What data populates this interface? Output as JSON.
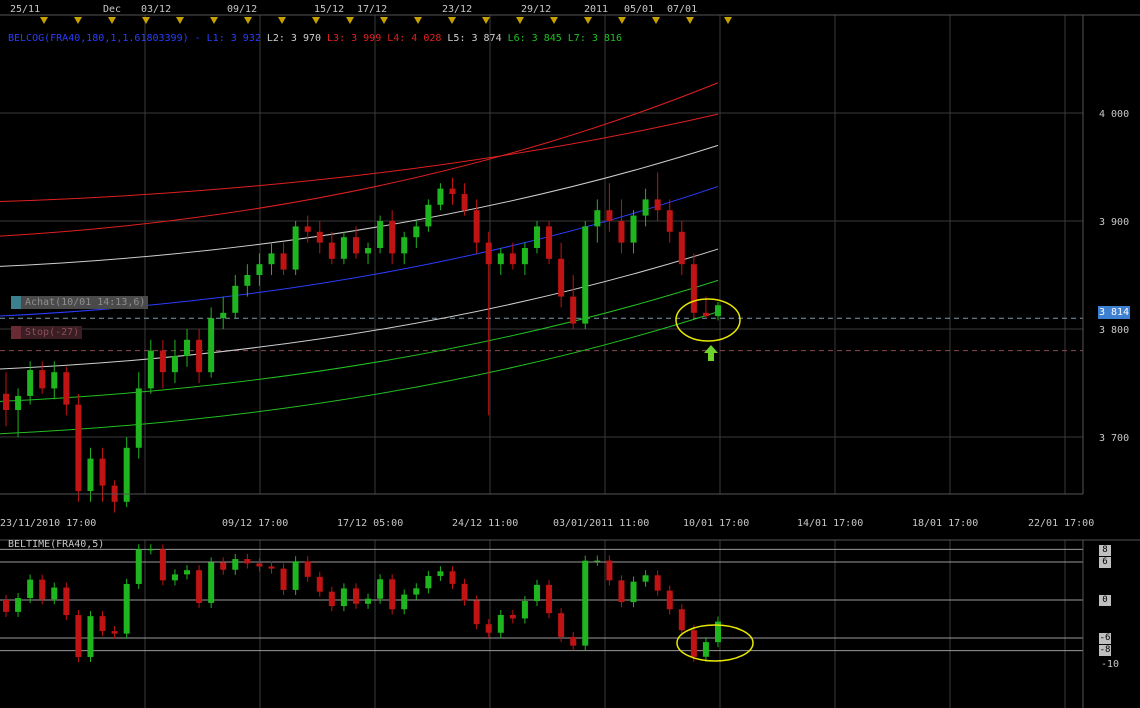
{
  "top_date_labels": [
    "25/11",
    "Dec",
    "03/12",
    "09/12",
    "15/12",
    "17/12",
    "23/12",
    "29/12",
    "2011",
    "05/01",
    "07/01"
  ],
  "bottom_date_labels": [
    "23/11/2010 17:00",
    "09/12 17:00",
    "17/12 05:00",
    "24/12 11:00",
    "03/01/2011 11:00",
    "10/01 17:00",
    "14/01 17:00",
    "18/01 17:00",
    "22/01 17:00"
  ],
  "legend": {
    "prefix": "BELCOG(FRA40,180,1,1.61803399) -",
    "items": [
      {
        "text": "L1: 3 932",
        "color": "#2a3dff"
      },
      {
        "text": "L2: 3 970",
        "color": "#d0d0d0"
      },
      {
        "text": "L3: 3 999",
        "color": "#e02020"
      },
      {
        "text": "L4: 4 028",
        "color": "#e02020"
      },
      {
        "text": "L5: 3 874",
        "color": "#d0d0d0"
      },
      {
        "text": "L6: 3 845",
        "color": "#22c022"
      },
      {
        "text": "L7: 3 816",
        "color": "#22c022"
      }
    ]
  },
  "badges": {
    "buy": "Achat(10/01 14:13,6)",
    "stop": "Stop(-27)"
  },
  "price_tag": "3 814",
  "subchart": {
    "title": "BELTIME(FRA40,5)",
    "axis_labels": [
      "8",
      "6",
      "0",
      "-6",
      "-8",
      "-10"
    ]
  },
  "colors": {
    "up": "#1fb51f",
    "down": "#c01414",
    "blue": "#2a3dff",
    "white": "#cfcfcf",
    "red": "#e02020",
    "green": "#22c022",
    "grid": "#3a3a3a",
    "highlight": "#e8e800",
    "arrow": "#6fd12b"
  },
  "chart_data": [
    {
      "type": "candlestick",
      "instrument": "FRA40",
      "yticks": [
        4000,
        3900,
        3800,
        3700
      ],
      "ylim": [
        3625,
        4080
      ],
      "current_price": 3814,
      "ref_lines": [
        3810,
        3780
      ],
      "bands": [
        {
          "name": "L3",
          "color": "#e02020",
          "start": 3918,
          "end": 3999,
          "slope": "up"
        },
        {
          "name": "L4",
          "color": "#e02020",
          "start": 3886,
          "end": 4028,
          "slope": "up"
        },
        {
          "name": "L2",
          "color": "#cfcfcf",
          "start": 3858,
          "end": 3970,
          "slope": "up"
        },
        {
          "name": "L1",
          "color": "#2a3dff",
          "start": 3812,
          "end": 3932,
          "slope": "up"
        },
        {
          "name": "L5",
          "color": "#cfcfcf",
          "start": 3763,
          "end": 3874,
          "slope": "up"
        },
        {
          "name": "L6",
          "color": "#22c022",
          "start": 3733,
          "end": 3845,
          "slope": "up"
        },
        {
          "name": "L7",
          "color": "#22c022",
          "start": 3703,
          "end": 3816,
          "slope": "up"
        }
      ],
      "candles": [
        [
          3740,
          3760,
          3710,
          3725
        ],
        [
          3725,
          3745,
          3700,
          3738
        ],
        [
          3738,
          3770,
          3730,
          3762
        ],
        [
          3762,
          3770,
          3740,
          3745
        ],
        [
          3745,
          3770,
          3735,
          3760
        ],
        [
          3760,
          3765,
          3720,
          3730
        ],
        [
          3730,
          3740,
          3640,
          3650
        ],
        [
          3650,
          3690,
          3640,
          3680
        ],
        [
          3680,
          3690,
          3640,
          3655
        ],
        [
          3655,
          3660,
          3630,
          3640
        ],
        [
          3640,
          3700,
          3635,
          3690
        ],
        [
          3690,
          3760,
          3680,
          3745
        ],
        [
          3745,
          3790,
          3740,
          3780
        ],
        [
          3780,
          3790,
          3745,
          3760
        ],
        [
          3760,
          3790,
          3750,
          3775
        ],
        [
          3775,
          3800,
          3765,
          3790
        ],
        [
          3790,
          3800,
          3750,
          3760
        ],
        [
          3760,
          3820,
          3755,
          3810
        ],
        [
          3810,
          3830,
          3800,
          3815
        ],
        [
          3815,
          3850,
          3810,
          3840
        ],
        [
          3840,
          3860,
          3830,
          3850
        ],
        [
          3850,
          3870,
          3840,
          3860
        ],
        [
          3860,
          3880,
          3850,
          3870
        ],
        [
          3870,
          3880,
          3850,
          3855
        ],
        [
          3855,
          3900,
          3850,
          3895
        ],
        [
          3895,
          3905,
          3880,
          3890
        ],
        [
          3890,
          3900,
          3870,
          3880
        ],
        [
          3880,
          3890,
          3860,
          3865
        ],
        [
          3865,
          3890,
          3860,
          3885
        ],
        [
          3885,
          3895,
          3865,
          3870
        ],
        [
          3870,
          3880,
          3860,
          3875
        ],
        [
          3875,
          3905,
          3870,
          3900
        ],
        [
          3900,
          3910,
          3860,
          3870
        ],
        [
          3870,
          3890,
          3860,
          3885
        ],
        [
          3885,
          3900,
          3875,
          3895
        ],
        [
          3895,
          3920,
          3890,
          3915
        ],
        [
          3915,
          3935,
          3910,
          3930
        ],
        [
          3930,
          3940,
          3915,
          3925
        ],
        [
          3925,
          3935,
          3905,
          3910
        ],
        [
          3910,
          3920,
          3870,
          3880
        ],
        [
          3880,
          3890,
          3720,
          3860
        ],
        [
          3860,
          3875,
          3850,
          3870
        ],
        [
          3870,
          3880,
          3855,
          3860
        ],
        [
          3860,
          3880,
          3850,
          3875
        ],
        [
          3875,
          3900,
          3870,
          3895
        ],
        [
          3895,
          3900,
          3860,
          3865
        ],
        [
          3865,
          3880,
          3820,
          3830
        ],
        [
          3830,
          3850,
          3800,
          3805
        ],
        [
          3805,
          3900,
          3800,
          3895
        ],
        [
          3895,
          3920,
          3880,
          3910
        ],
        [
          3910,
          3935,
          3890,
          3900
        ],
        [
          3900,
          3920,
          3870,
          3880
        ],
        [
          3880,
          3910,
          3870,
          3905
        ],
        [
          3905,
          3930,
          3895,
          3920
        ],
        [
          3920,
          3945,
          3900,
          3910
        ],
        [
          3910,
          3920,
          3880,
          3890
        ],
        [
          3890,
          3900,
          3850,
          3860
        ],
        [
          3860,
          3870,
          3810,
          3815
        ],
        [
          3815,
          3830,
          3810,
          3812
        ],
        [
          3812,
          3825,
          3808,
          3822
        ]
      ]
    },
    {
      "type": "bar",
      "indicator": "BELTIME(FRA40,5)",
      "ylim": [
        -10,
        9
      ],
      "levels": [
        8,
        6,
        0,
        -6,
        -8
      ],
      "note": "oscillator shown as candlestick-like bars"
    }
  ]
}
